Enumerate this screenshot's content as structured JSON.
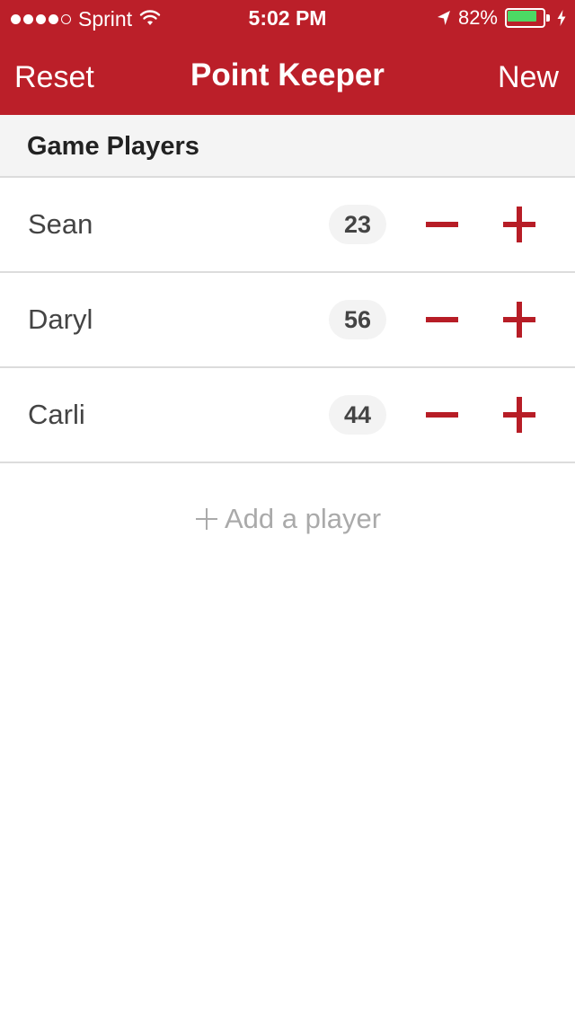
{
  "colors": {
    "brand_red": "#bb1f29",
    "battery_green": "#4cd964",
    "accent_red": "#b71d26"
  },
  "status_bar": {
    "signal_dots_filled": 4,
    "signal_dots_total": 5,
    "carrier": "Sprint",
    "time": "5:02 PM",
    "battery_percent_text": "82%",
    "battery_level": 0.82,
    "icons": [
      "wifi-icon",
      "location-arrow-icon",
      "battery-icon",
      "charging-bolt-icon"
    ]
  },
  "nav": {
    "left_label": "Reset",
    "title": "Point Keeper",
    "right_label": "New"
  },
  "section": {
    "title": "Game Players"
  },
  "players": [
    {
      "name": "Sean",
      "score": "23"
    },
    {
      "name": "Daryl",
      "score": "56"
    },
    {
      "name": "Carli",
      "score": "44"
    }
  ],
  "add_player": {
    "label": "Add a player",
    "icon": "plus-icon"
  }
}
